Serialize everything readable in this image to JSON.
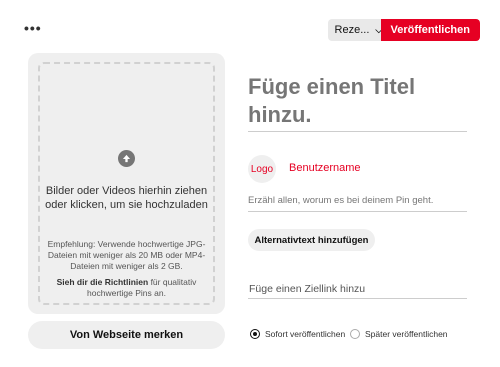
{
  "topbar": {
    "more_label": "•••",
    "board_select_value": "Reze...",
    "board_select_icon": "chevron-down-icon",
    "publish_label": "Veröffentlichen"
  },
  "upload": {
    "icon": "arrow-up-icon",
    "prompt": "Bilder oder Videos hierhin ziehen oder klicken, um sie hochzuladen",
    "recommendation": "Empfehlung: Verwende hochwertige JPG-Dateien mit weniger als 20 MB oder MP4-Dateien mit weniger als 2 GB.",
    "guidelines_bold": "Sieh dir die Richtlinien",
    "guidelines_rest": " für qualitativ hochwertige Pins an."
  },
  "from_website_label": "Von Webseite merken",
  "title_placeholder": "Füge einen Titel hinzu.",
  "profile": {
    "logo_label": "Logo",
    "username": "Benutzername"
  },
  "description_placeholder": "Erzähl allen, worum es bei deinem Pin geht.",
  "alt_text_button": "Alternativtext hinzufügen",
  "link_placeholder": "Füge einen Ziellink hinzu",
  "publish_options": {
    "now_label": "Sofort veröffentlichen",
    "later_label": "Später veröffentlichen",
    "selected": "now"
  },
  "colors": {
    "accent": "#e60023",
    "panel_bg": "#efefef"
  }
}
